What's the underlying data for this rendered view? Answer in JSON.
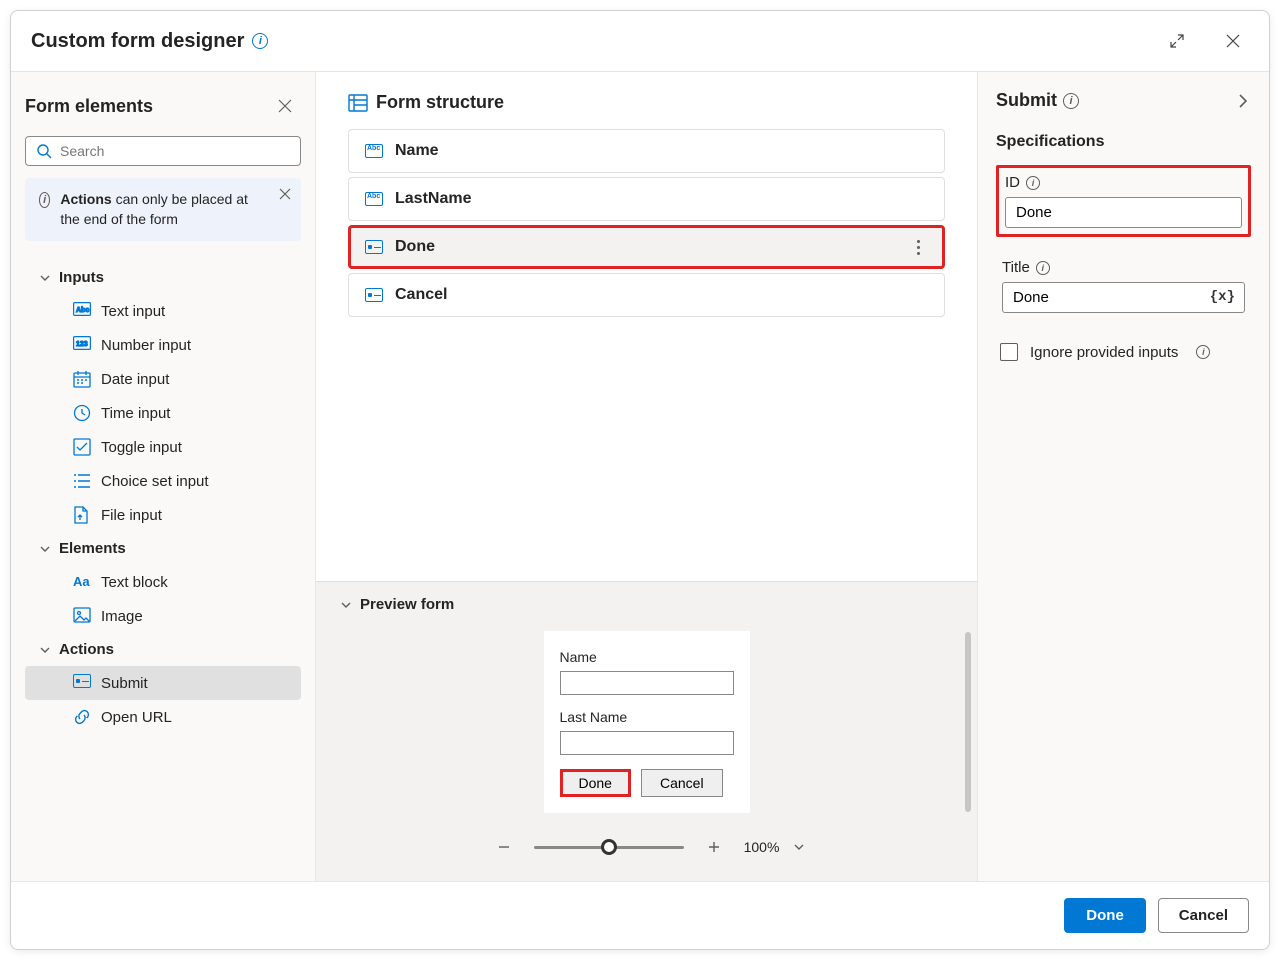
{
  "header": {
    "title": "Custom form designer"
  },
  "left": {
    "title": "Form elements",
    "search_placeholder": "Search",
    "notice_strong": "Actions",
    "notice_rest": " can only be placed at the end of the form",
    "groups": {
      "inputs": {
        "label": "Inputs",
        "items": [
          {
            "label": "Text input"
          },
          {
            "label": "Number input"
          },
          {
            "label": "Date input"
          },
          {
            "label": "Time input"
          },
          {
            "label": "Toggle input"
          },
          {
            "label": "Choice set input"
          },
          {
            "label": "File input"
          }
        ]
      },
      "elements": {
        "label": "Elements",
        "items": [
          {
            "label": "Text block"
          },
          {
            "label": "Image"
          }
        ]
      },
      "actions": {
        "label": "Actions",
        "items": [
          {
            "label": "Submit"
          },
          {
            "label": "Open URL"
          }
        ]
      }
    }
  },
  "center": {
    "structure_title": "Form structure",
    "items": [
      {
        "label": "Name"
      },
      {
        "label": "LastName"
      },
      {
        "label": "Done"
      },
      {
        "label": "Cancel"
      }
    ],
    "preview": {
      "title": "Preview form",
      "name_label": "Name",
      "lastname_label": "Last Name",
      "done_btn": "Done",
      "cancel_btn": "Cancel",
      "zoom": "100%"
    }
  },
  "right": {
    "title": "Submit",
    "spec_title": "Specifications",
    "id_label": "ID",
    "id_value": "Done",
    "title_label": "Title",
    "title_value": "Done",
    "ignore_label": "Ignore provided inputs"
  },
  "footer": {
    "done": "Done",
    "cancel": "Cancel"
  }
}
